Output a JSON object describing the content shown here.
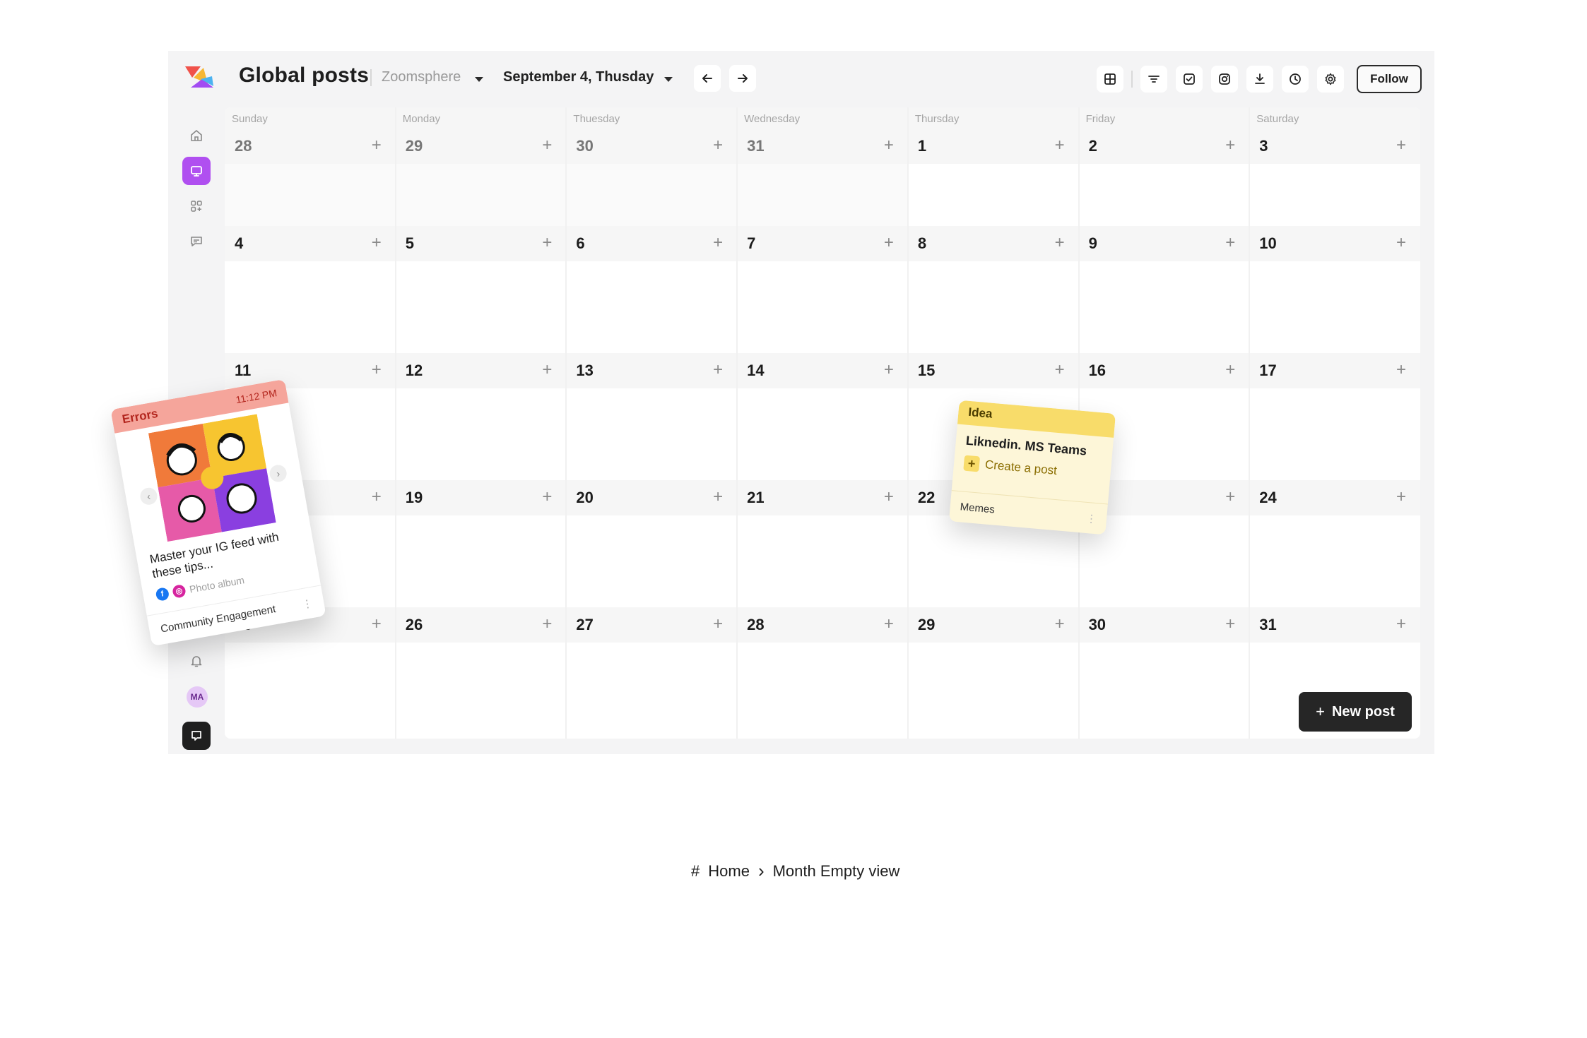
{
  "header": {
    "title": "Global posts",
    "workspace": "Zoomsphere",
    "date_label": "September 4, Thusday",
    "follow_label": "Follow",
    "tools": [
      "grid-view-icon",
      "filter-icon",
      "checkbox-icon",
      "instagram-icon",
      "download-icon",
      "clock-icon",
      "gear-icon"
    ]
  },
  "sidebar": {
    "items": [
      "home-icon",
      "monitor-icon",
      "apps-icon",
      "chat-icon"
    ],
    "bottom": [
      "bell-icon",
      "avatar",
      "chat-bubble-icon"
    ],
    "avatar_initials": "MA"
  },
  "calendar": {
    "day_headers": [
      "Sunday",
      "Monday",
      "Thuesday",
      "Wednesday",
      "Thursday",
      "Friday",
      "Saturday"
    ],
    "weeks": [
      [
        "28",
        "29",
        "30",
        "31",
        "1",
        "2",
        "3"
      ],
      [
        "4",
        "5",
        "6",
        "7",
        "8",
        "9",
        "10"
      ],
      [
        "11",
        "12",
        "13",
        "14",
        "15",
        "16",
        "17"
      ],
      [
        "",
        "19",
        "20",
        "21",
        "22",
        "",
        "24"
      ],
      [
        "25",
        "26",
        "27",
        "28",
        "29",
        "30",
        "31"
      ]
    ],
    "add_symbol": "+",
    "new_post_label": "New post"
  },
  "errors_card": {
    "label": "Errors",
    "time": "11:12 PM",
    "title": "Master your IG feed with these tips...",
    "type": "Photo album",
    "footer": "Community Engagement",
    "more": "⋮"
  },
  "idea_card": {
    "label": "Idea",
    "title": "Liknedin. MS Teams",
    "create": "Create a post",
    "footer": "Memes",
    "more": "⋮"
  },
  "breadcrumb": {
    "hash": "#",
    "home": "Home",
    "sep": "›",
    "current": "Month Empty view"
  },
  "colors": {
    "accent": "#b04ff0",
    "error": "#f5a59b",
    "idea": "#f8dc6a",
    "dark": "#262626"
  }
}
